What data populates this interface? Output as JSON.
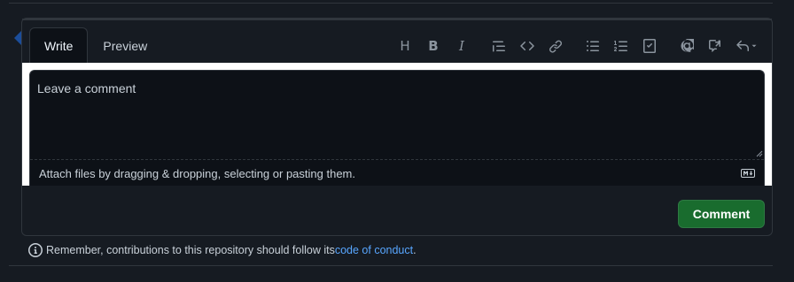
{
  "tabs": [
    {
      "label": "Write",
      "active": true
    },
    {
      "label": "Preview",
      "active": false
    }
  ],
  "toolbar": {
    "heading_label": "H",
    "bold_label": "B",
    "italic_label": "I"
  },
  "editor": {
    "placeholder": "Leave a comment",
    "value": "",
    "attach_text": "Attach files by dragging & dropping, selecting or pasting them."
  },
  "actions": {
    "comment_label": "Comment"
  },
  "note": {
    "prefix": "Remember, contributions to this repository should follow its ",
    "link_text": "code of conduct",
    "suffix": "."
  },
  "colors": {
    "accent": "#58a6ff",
    "primary_button": "#196c2e",
    "background": "#161b22",
    "editor_bg": "#0d1117"
  }
}
